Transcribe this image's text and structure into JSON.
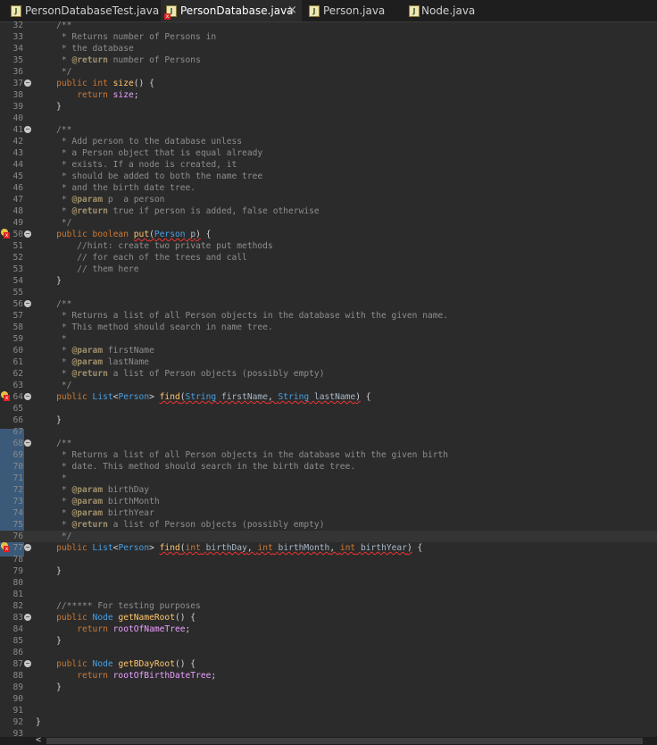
{
  "tabs": [
    {
      "label": "PersonDatabaseTest.java",
      "active": false,
      "error": false
    },
    {
      "label": "PersonDatabase.java",
      "active": true,
      "error": true,
      "close": "×"
    },
    {
      "label": "Person.java",
      "active": false,
      "error": false
    },
    {
      "label": "Node.java",
      "active": false,
      "error": false
    }
  ],
  "lines": [
    {
      "n": "32",
      "code": "    /**"
    },
    {
      "n": "33",
      "code": "     * Returns number of Persons in"
    },
    {
      "n": "34",
      "code": "     * the database"
    },
    {
      "n": "35",
      "code": "     * @return number of Persons"
    },
    {
      "n": "36",
      "code": "     */"
    },
    {
      "n": "37",
      "code": "    public int size() {"
    },
    {
      "n": "38",
      "code": "        return size;"
    },
    {
      "n": "39",
      "code": "    }"
    },
    {
      "n": "40",
      "code": ""
    },
    {
      "n": "41",
      "code": "    /**"
    },
    {
      "n": "42",
      "code": "     * Add person to the database unless"
    },
    {
      "n": "43",
      "code": "     * a Person object that is equal already"
    },
    {
      "n": "44",
      "code": "     * exists. If a node is created, it"
    },
    {
      "n": "45",
      "code": "     * should be added to both the name tree"
    },
    {
      "n": "46",
      "code": "     * and the birth date tree."
    },
    {
      "n": "47",
      "code": "     * @param p  a person"
    },
    {
      "n": "48",
      "code": "     * @return true if person is added, false otherwise"
    },
    {
      "n": "49",
      "code": "     */"
    },
    {
      "n": "50",
      "code": "    public boolean put(Person p) {"
    },
    {
      "n": "51",
      "code": "        //hint: create two private put methods"
    },
    {
      "n": "52",
      "code": "        // for each of the trees and call"
    },
    {
      "n": "53",
      "code": "        // them here"
    },
    {
      "n": "54",
      "code": "    }"
    },
    {
      "n": "55",
      "code": ""
    },
    {
      "n": "56",
      "code": "    /**"
    },
    {
      "n": "57",
      "code": "     * Returns a list of all Person objects in the database with the given name."
    },
    {
      "n": "58",
      "code": "     * This method should search in name tree."
    },
    {
      "n": "59",
      "code": "     *"
    },
    {
      "n": "60",
      "code": "     * @param firstName"
    },
    {
      "n": "61",
      "code": "     * @param lastName"
    },
    {
      "n": "62",
      "code": "     * @return a list of Person objects (possibly empty)"
    },
    {
      "n": "63",
      "code": "     */"
    },
    {
      "n": "64",
      "code": "    public List<Person> find(String firstName, String lastName) {"
    },
    {
      "n": "65",
      "code": ""
    },
    {
      "n": "66",
      "code": "    }"
    },
    {
      "n": "67",
      "code": ""
    },
    {
      "n": "68",
      "code": "    /**"
    },
    {
      "n": "69",
      "code": "     * Returns a list of all Person objects in the database with the given birth"
    },
    {
      "n": "70",
      "code": "     * date. This method should search in the birth date tree."
    },
    {
      "n": "71",
      "code": "     *"
    },
    {
      "n": "72",
      "code": "     * @param birthDay"
    },
    {
      "n": "73",
      "code": "     * @param birthMonth"
    },
    {
      "n": "74",
      "code": "     * @param birthYear"
    },
    {
      "n": "75",
      "code": "     * @return a list of Person objects (possibly empty)"
    },
    {
      "n": "76",
      "code": "     */"
    },
    {
      "n": "77",
      "code": "    public List<Person> find(int birthDay, int birthMonth, int birthYear) {"
    },
    {
      "n": "78",
      "code": ""
    },
    {
      "n": "79",
      "code": "    }"
    },
    {
      "n": "80",
      "code": ""
    },
    {
      "n": "81",
      "code": ""
    },
    {
      "n": "82",
      "code": "    //***** For testing purposes"
    },
    {
      "n": "83",
      "code": "    public Node getNameRoot() {"
    },
    {
      "n": "84",
      "code": "        return rootOfNameTree;"
    },
    {
      "n": "85",
      "code": "    }"
    },
    {
      "n": "86",
      "code": ""
    },
    {
      "n": "87",
      "code": "    public Node getBDayRoot() {"
    },
    {
      "n": "88",
      "code": "        return rootOfBirthDateTree;"
    },
    {
      "n": "89",
      "code": "    }"
    },
    {
      "n": "90",
      "code": ""
    },
    {
      "n": "91",
      "code": ""
    },
    {
      "n": "92",
      "code": "}"
    },
    {
      "n": "93",
      "code": ""
    }
  ],
  "scroll_left_glyph": "<",
  "colors": {
    "background": "#2b2b2b",
    "keyword": "#cc7832",
    "method": "#ffc66d",
    "type": "#4a9fe0",
    "field": "#eaa0ff",
    "comment": "#8e8e8e",
    "error_underline": "#ee3333"
  }
}
